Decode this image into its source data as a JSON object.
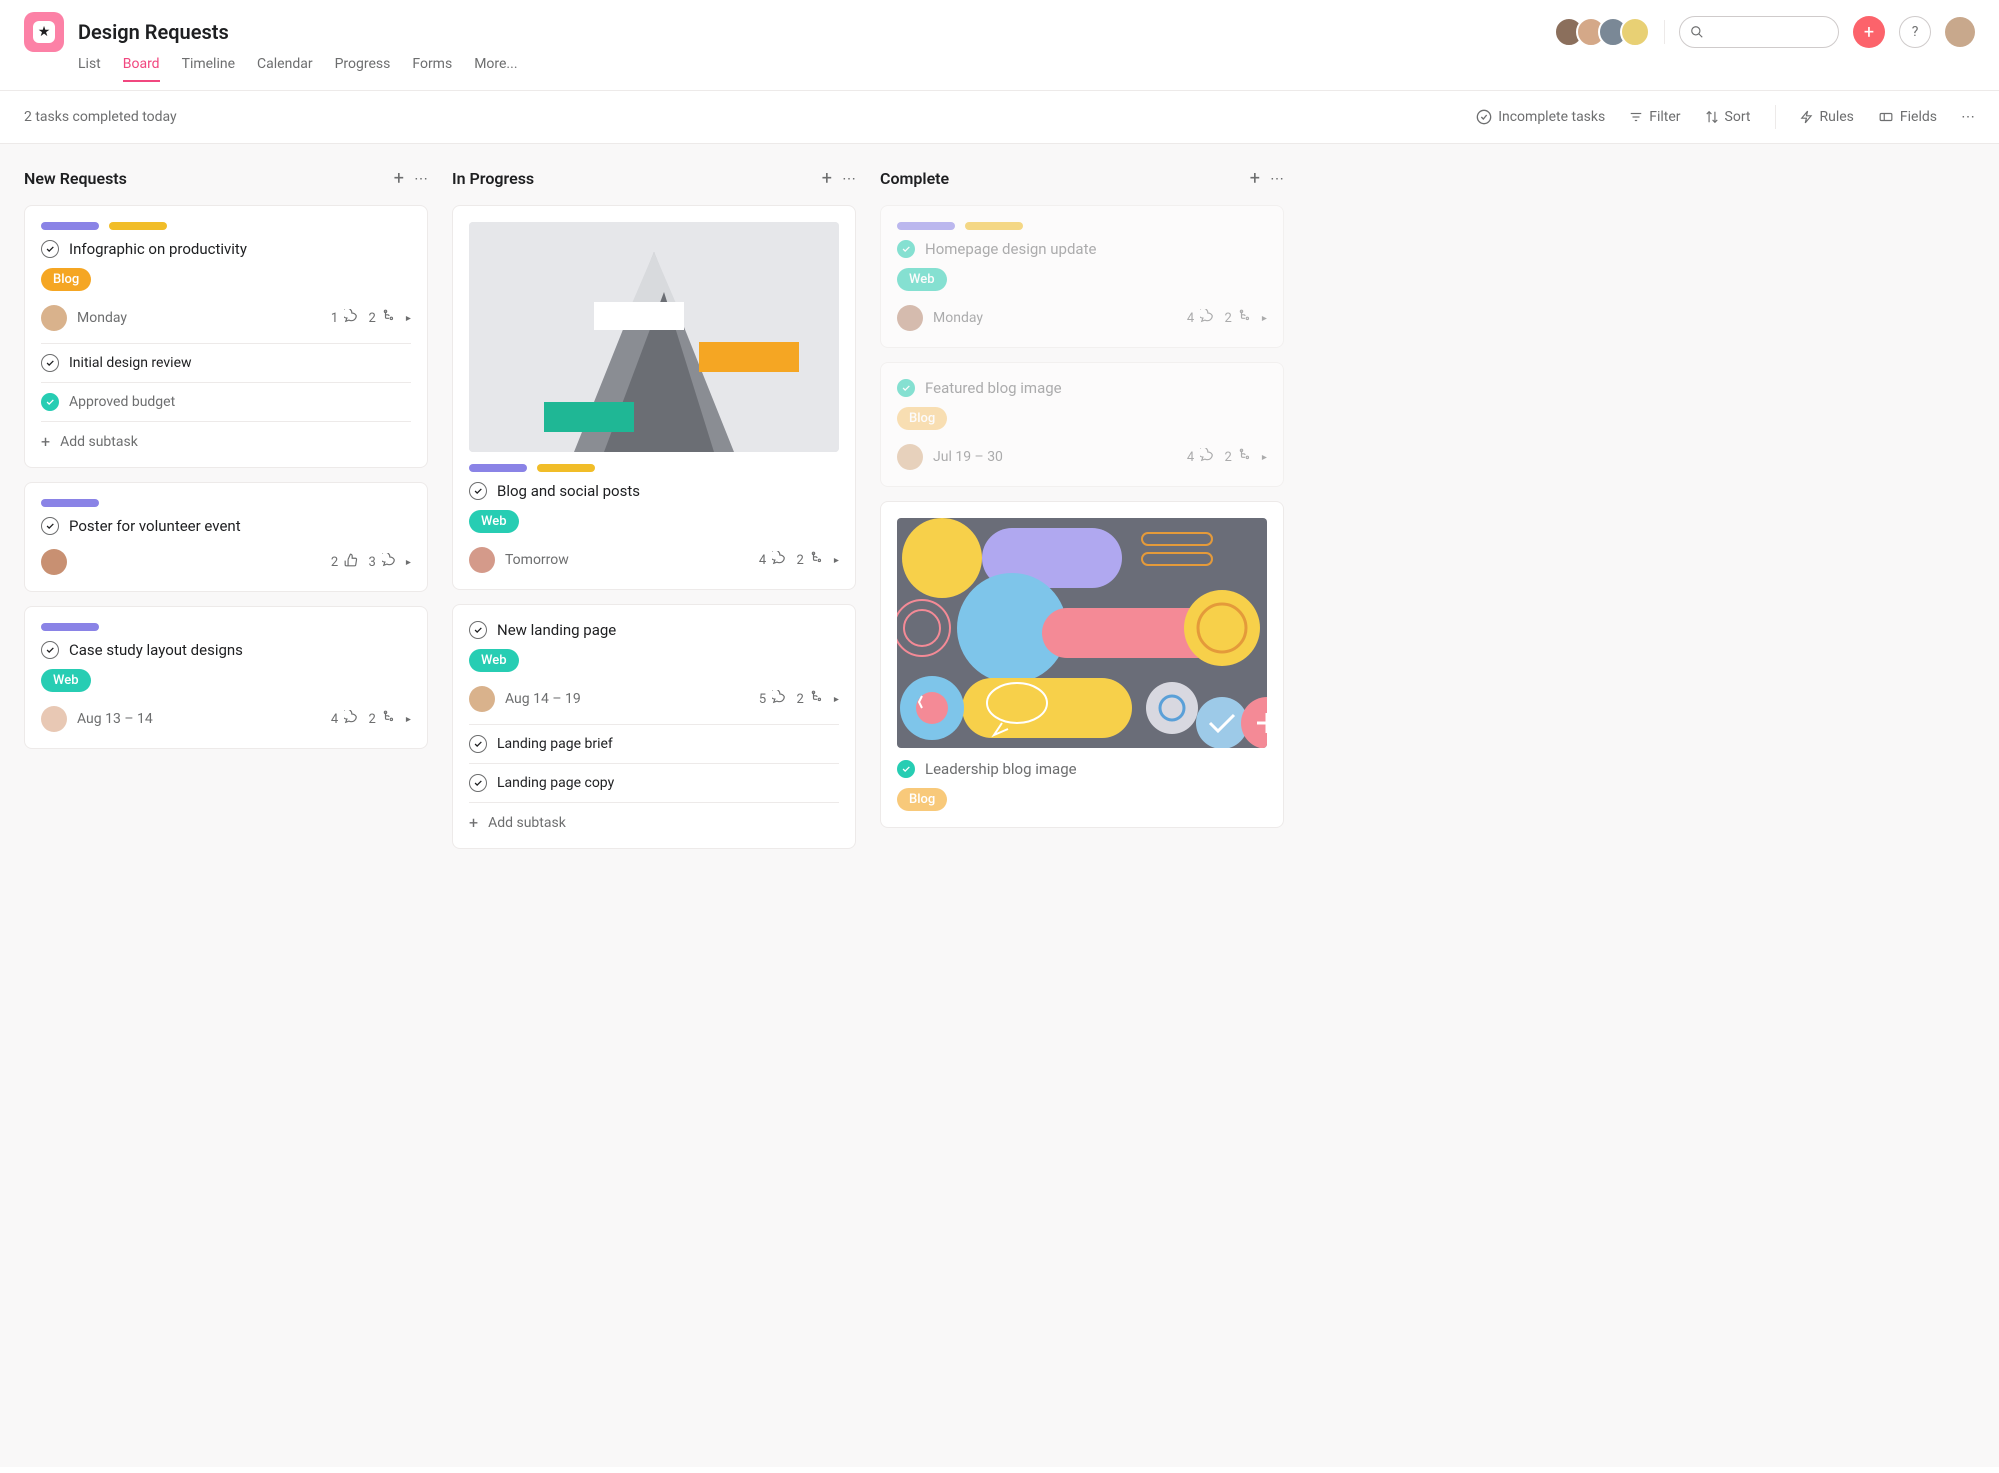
{
  "project": {
    "title": "Design Requests"
  },
  "tabs": [
    "List",
    "Board",
    "Timeline",
    "Calendar",
    "Progress",
    "Forms",
    "More..."
  ],
  "active_tab": "Board",
  "toolbar": {
    "status": "2 tasks completed today",
    "incomplete": "Incomplete tasks",
    "filter": "Filter",
    "sort": "Sort",
    "rules": "Rules",
    "fields": "Fields"
  },
  "columns": [
    {
      "title": "New Requests",
      "cards": [
        {
          "pills": [
            "purple",
            "yellow"
          ],
          "title": "Infographic on productivity",
          "tag": "Blog",
          "tag_style": "blog",
          "assignee_color": "#d9b28c",
          "date": "Monday",
          "stats": {
            "a": "1",
            "a_icon": "comment",
            "b": "2",
            "b_icon": "subtask"
          },
          "subtasks": [
            {
              "done": false,
              "title": "Initial design review"
            },
            {
              "done": true,
              "title": "Approved budget"
            }
          ],
          "add_subtask": "Add subtask"
        },
        {
          "pills": [
            "purple"
          ],
          "title": "Poster for volunteer event",
          "assignee_color": "#c89072",
          "stats": {
            "a": "2",
            "a_icon": "like",
            "b": "3",
            "b_icon": "comment"
          }
        },
        {
          "pills": [
            "purple"
          ],
          "title": "Case study layout designs",
          "tag": "Web",
          "tag_style": "web",
          "assignee_color": "#e8c8b4",
          "date": "Aug 13 – 14",
          "stats": {
            "a": "4",
            "a_icon": "comment",
            "b": "2",
            "b_icon": "subtask"
          }
        }
      ]
    },
    {
      "title": "In Progress",
      "cards": [
        {
          "cover": "mountain",
          "pills": [
            "purple",
            "yellow"
          ],
          "title": "Blog and social posts",
          "tag": "Web",
          "tag_style": "web",
          "assignee_color": "#d49a8a",
          "date": "Tomorrow",
          "stats": {
            "a": "4",
            "a_icon": "comment",
            "b": "2",
            "b_icon": "subtask"
          }
        },
        {
          "title": "New landing page",
          "tag": "Web",
          "tag_style": "web",
          "assignee_color": "#d9b28c",
          "date": "Aug 14 – 19",
          "stats": {
            "a": "5",
            "a_icon": "comment",
            "b": "2",
            "b_icon": "subtask"
          },
          "subtasks": [
            {
              "done": false,
              "title": "Landing page brief"
            },
            {
              "done": false,
              "title": "Landing page copy"
            }
          ],
          "add_subtask": "Add subtask"
        }
      ]
    },
    {
      "title": "Complete",
      "cards": [
        {
          "dim": true,
          "done": true,
          "pills": [
            "purple",
            "yellow"
          ],
          "title": "Homepage design update",
          "tag": "Web",
          "tag_style": "web",
          "assignee_color": "#b88a72",
          "date": "Monday",
          "stats": {
            "a": "4",
            "a_icon": "comment",
            "b": "2",
            "b_icon": "subtask"
          }
        },
        {
          "dim": true,
          "done": true,
          "title": "Featured blog image",
          "tag": "Blog",
          "tag_style": "blog-dim",
          "assignee_color": "#d9b28c",
          "date": "Jul 19 – 30",
          "stats": {
            "a": "4",
            "a_icon": "comment",
            "b": "2",
            "b_icon": "subtask"
          }
        },
        {
          "cover": "abstract",
          "done": true,
          "title": "Leadership blog image",
          "tag": "Blog",
          "tag_style": "blog-dim"
        }
      ]
    }
  ]
}
